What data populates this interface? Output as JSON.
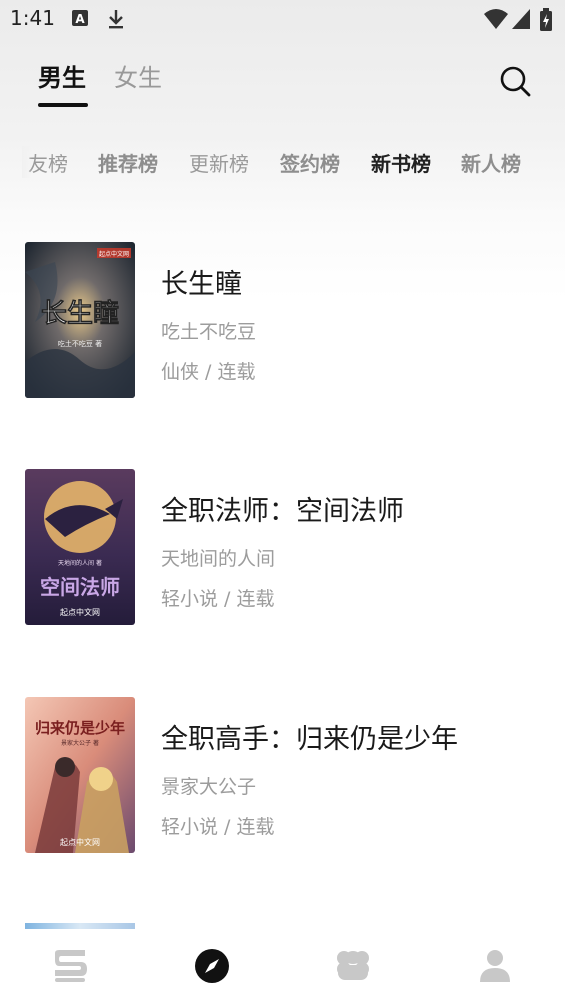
{
  "status_bar": {
    "time": "1:41",
    "icons": [
      "text-a-icon",
      "download-icon",
      "wifi-icon",
      "signal-icon",
      "battery-icon"
    ]
  },
  "gender_tabs": [
    {
      "label": "男生",
      "active": true
    },
    {
      "label": "女生",
      "active": false
    }
  ],
  "search": {
    "icon": "search-icon"
  },
  "rank_tabs": [
    {
      "label": "友榜",
      "active": false
    },
    {
      "label": "推荐榜",
      "active": false
    },
    {
      "label": "更新榜",
      "active": false
    },
    {
      "label": "签约榜",
      "active": false
    },
    {
      "label": "新书榜",
      "active": true
    },
    {
      "label": "新人榜",
      "active": false
    }
  ],
  "books": [
    {
      "title": "长生瞳",
      "author": "吃土不吃豆",
      "meta": "仙侠 / 连载",
      "cover": {
        "title_text": "长生瞳",
        "author_text": "吃土不吃豆 著",
        "publisher_text": "起点中文网"
      }
    },
    {
      "title": "全职法师：空间法师",
      "author": "天地间的人间",
      "meta": "轻小说 / 连载",
      "cover": {
        "title_text": "空间法师",
        "author_text": "天地间的人间 著",
        "publisher_text": "起点中文网"
      }
    },
    {
      "title": "全职高手：归来仍是少年",
      "author": "景家大公子",
      "meta": "轻小说 / 连载",
      "cover": {
        "title_text": "归来仍是少年",
        "author_text": "景家大公子 著",
        "publisher_text": "起点中文网"
      }
    }
  ],
  "bottom_nav": [
    {
      "icon": "bookshelf-icon",
      "active": false
    },
    {
      "icon": "compass-icon",
      "active": true
    },
    {
      "icon": "category-icon",
      "active": false
    },
    {
      "icon": "profile-icon",
      "active": false
    }
  ],
  "colors": {
    "primary_text": "#1a1a1a",
    "secondary_text": "#9c9c9c",
    "inactive_nav": "#c8c8c8",
    "active_nav": "#111111"
  }
}
